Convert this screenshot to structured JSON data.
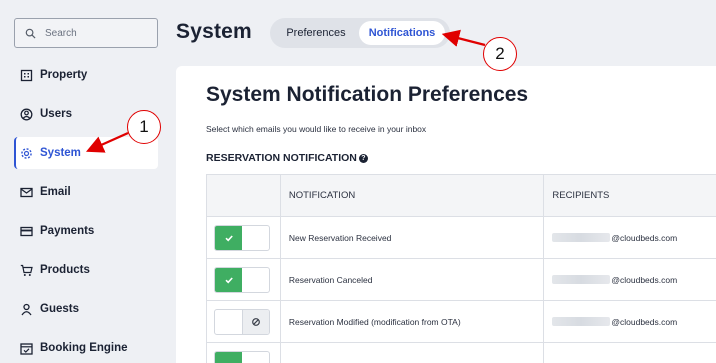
{
  "search": {
    "placeholder": "Search"
  },
  "sidebar": {
    "items": [
      {
        "label": "Property",
        "icon": "building-icon"
      },
      {
        "label": "Users",
        "icon": "user-circle-icon"
      },
      {
        "label": "System",
        "icon": "gear-icon",
        "active": true
      },
      {
        "label": "Email",
        "icon": "envelope-icon"
      },
      {
        "label": "Payments",
        "icon": "credit-card-icon"
      },
      {
        "label": "Products",
        "icon": "cart-icon"
      },
      {
        "label": "Guests",
        "icon": "person-icon"
      },
      {
        "label": "Booking Engine",
        "icon": "calendar-check-icon"
      }
    ]
  },
  "header": {
    "title": "System",
    "tabs": [
      {
        "label": "Preferences",
        "active": false
      },
      {
        "label": "Notifications",
        "active": true
      }
    ]
  },
  "main": {
    "title": "System Notification Preferences",
    "subtitle": "Select which emails you would like to receive in your inbox",
    "section": "RESERVATION NOTIFICATION",
    "columns": [
      "",
      "NOTIFICATION",
      "RECIPIENTS"
    ],
    "rows": [
      {
        "enabled": true,
        "notification": "New Reservation Received",
        "recipient": "@cloudbeds.com"
      },
      {
        "enabled": true,
        "notification": "Reservation Canceled",
        "recipient": "@cloudbeds.com"
      },
      {
        "enabled": false,
        "notification": "Reservation Modified (modification from OTA)",
        "recipient": "@cloudbeds.com"
      }
    ]
  },
  "annotations": [
    {
      "number": "1"
    },
    {
      "number": "2"
    }
  ],
  "colors": {
    "accent": "#2f55d4",
    "toggle_on": "#3fae62",
    "annotation": "#e00000"
  }
}
